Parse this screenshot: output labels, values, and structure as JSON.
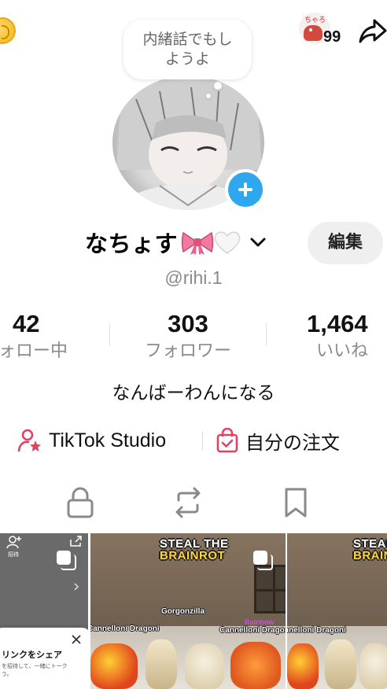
{
  "header": {
    "coin_icon": "coin-icon",
    "notification_badge_count": "99",
    "notification_avatar_tag": "ちゃろ",
    "share_icon": "share-arrow-icon"
  },
  "bubble": {
    "text_line1": "内緒話でもし",
    "text_line2": "ようよ"
  },
  "profile": {
    "display_name": "なちょす",
    "handle": "@rihi.1",
    "edit_label": "編集",
    "bio": "なんばーわんになる"
  },
  "stats": [
    {
      "value": "42",
      "label": "ォロー中"
    },
    {
      "value": "303",
      "label": "フォロワー"
    },
    {
      "value": "1,464",
      "label": "いいね"
    }
  ],
  "tools": {
    "studio_label": "TikTok Studio",
    "orders_label": "自分の注文"
  },
  "tabs": [
    "lock-icon",
    "repost-icon",
    "bookmark-icon"
  ],
  "grid": {
    "cell1": {
      "invite_label": "招待",
      "popup_title": "リンクをシェア",
      "popup_desc": "を招待して、一緒にトーク",
      "popup_desc2": "う。"
    },
    "cell2": {
      "brand_line1": "STEAL THE",
      "brand_line2": "BRAINROT",
      "label_gorgonzilla": "Gorgonzilla",
      "label_rainbow": "Rainbow",
      "label_cannelloni_left": "Cannelloni Dragoni",
      "label_cannelloni_right": "Cannelloni Dragoni"
    },
    "cell3": {
      "brand_line1": "STEAL",
      "brand_line2": "BRAIN",
      "label_cannelloni": "nnelloni Dragoni"
    }
  },
  "colors": {
    "accent_blue": "#2fa7ee",
    "studio_pink": "#e04262",
    "muted_gray": "#8a8a8a"
  }
}
